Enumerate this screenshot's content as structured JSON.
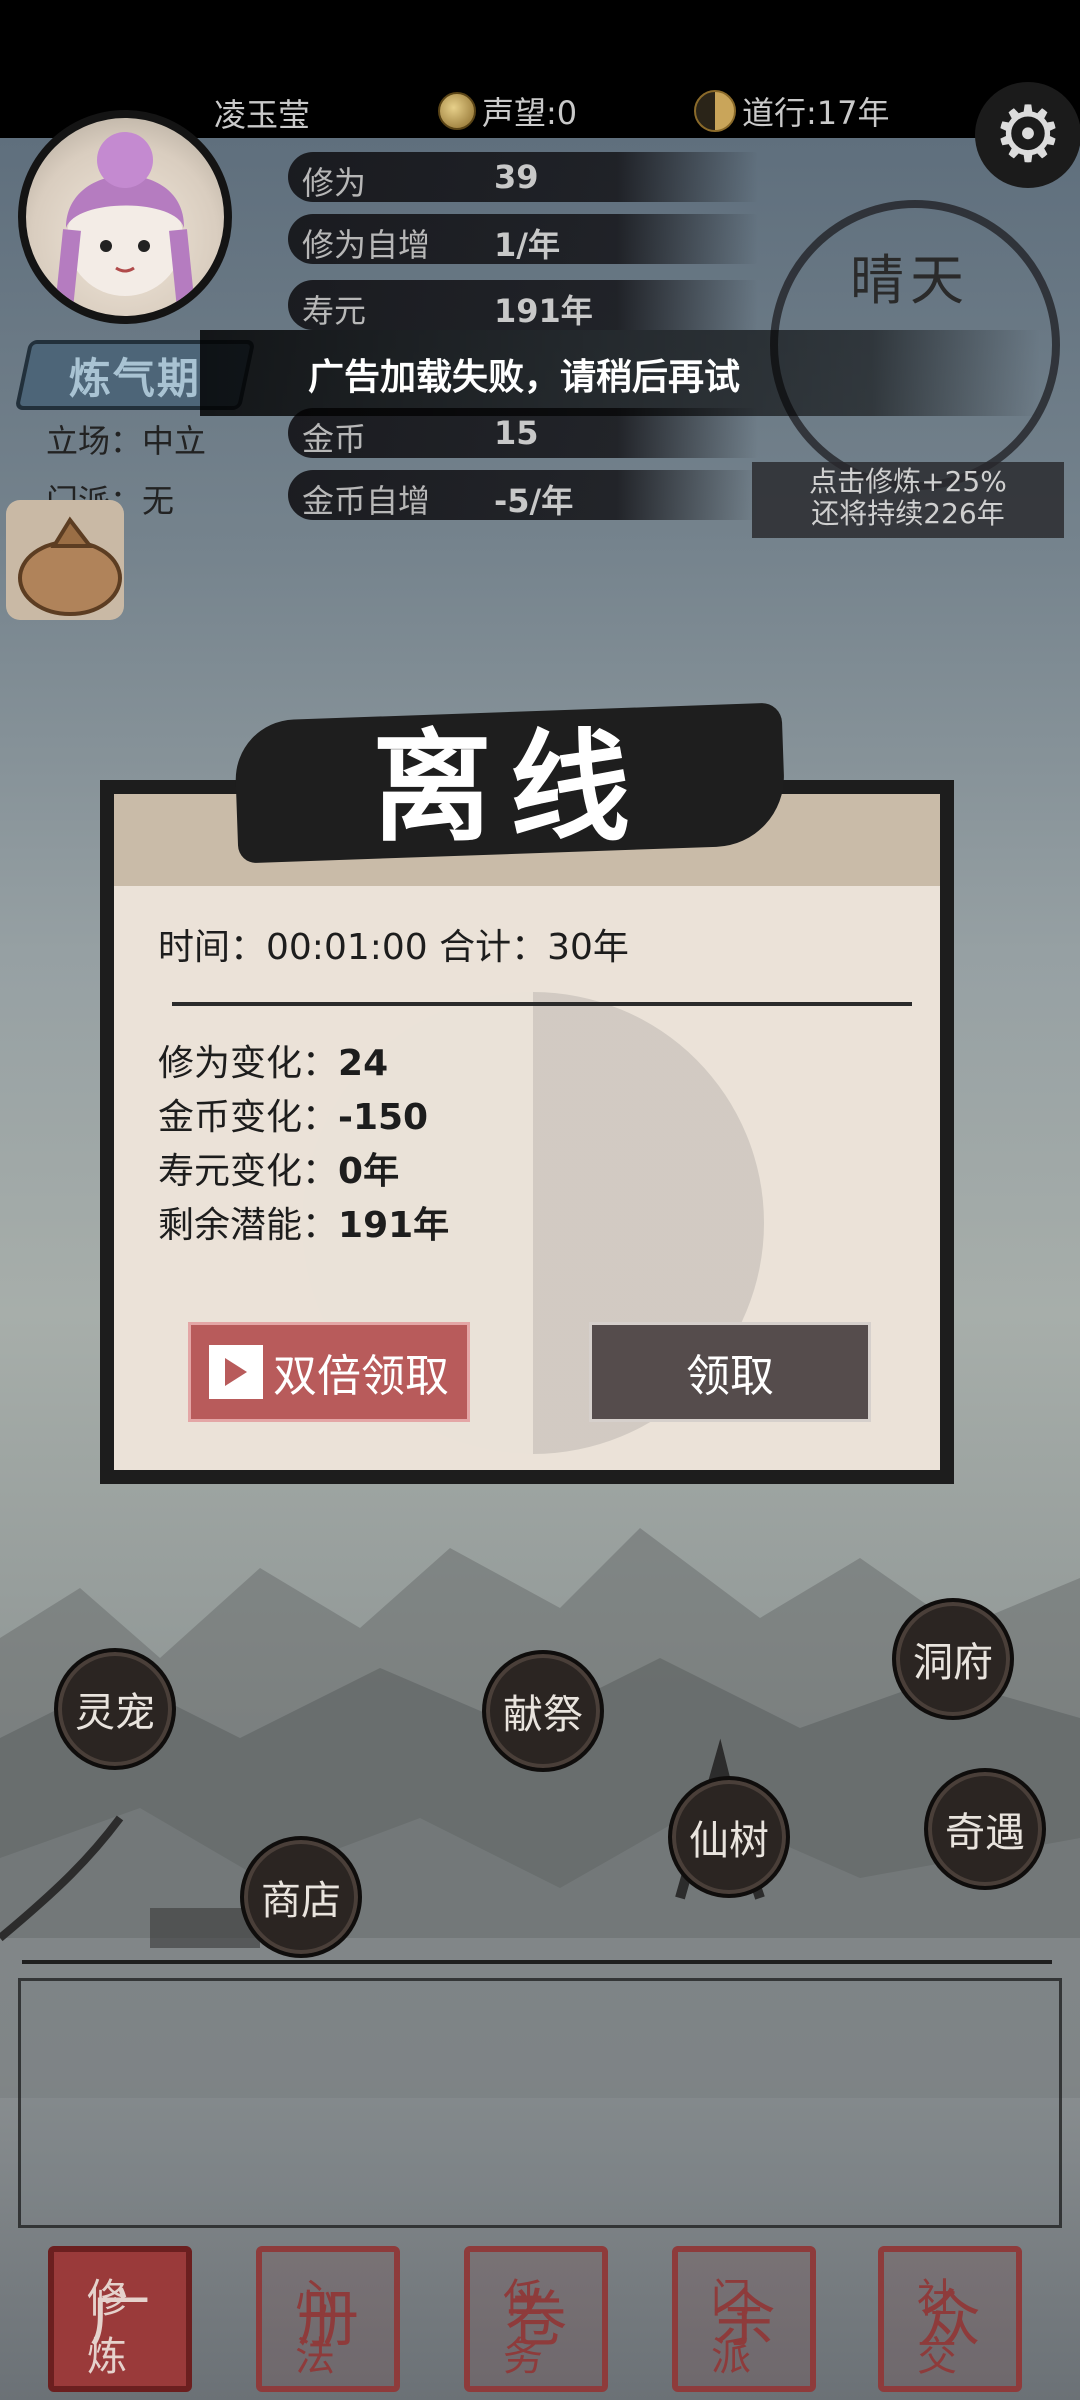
{
  "status_bar": {
    "player_name": "凌玉莹",
    "reputation_label": "声望:0",
    "dao_label": "道行:17年"
  },
  "player": {
    "realm": "炼气期",
    "stance": "立场：中立",
    "sect": "门派：无"
  },
  "stats": [
    {
      "label": "修为",
      "value": "39"
    },
    {
      "label": "修为自增",
      "value": "1/年"
    },
    {
      "label": "寿元",
      "value": "191年"
    },
    {
      "label": "金币",
      "value": "15"
    },
    {
      "label": "金币自增",
      "value": "-5/年"
    }
  ],
  "weather": {
    "label": "晴天",
    "boost_line1": "点击修炼+25%",
    "boost_line2": "还将持续226年"
  },
  "toast": {
    "message": "广告加载失败，请稍后再试"
  },
  "offline_dialog": {
    "title": "离线",
    "time_line": "时间：00:01:00  合计：30年",
    "rows": [
      {
        "label": "修为变化：",
        "value": "24"
      },
      {
        "label": "金币变化：",
        "value": "-150"
      },
      {
        "label": "寿元变化：",
        "value": "0年"
      },
      {
        "label": "剩余潜能：",
        "value": "191年"
      }
    ],
    "double_claim": "双倍领取",
    "claim": "领取"
  },
  "map_buttons": {
    "pet": "灵宠",
    "sacrifice": "献祭",
    "cave": "洞府",
    "fairy_tree": "仙树",
    "adventure": "奇遇",
    "shop": "商店"
  },
  "nav": [
    {
      "label": "修炼",
      "glyph": "广",
      "active": true
    },
    {
      "label": "心法",
      "glyph": "册",
      "active": false
    },
    {
      "label": "任务",
      "glyph": "卷",
      "active": false
    },
    {
      "label": "门派",
      "glyph": "余",
      "active": false
    },
    {
      "label": "社交",
      "glyph": "众",
      "active": false
    }
  ],
  "colors": {
    "accent_red": "#b85b5b",
    "dark_button": "#554c4c",
    "stamp_red": "#8e3b3b",
    "dialog_bg": "#ebe2d8"
  }
}
